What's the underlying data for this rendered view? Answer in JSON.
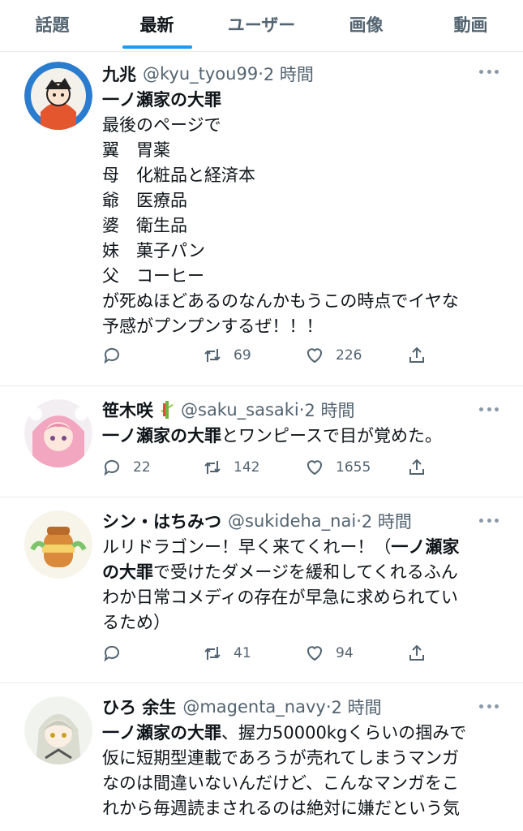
{
  "tabs": [
    {
      "label": "話題",
      "active": false
    },
    {
      "label": "最新",
      "active": true
    },
    {
      "label": "ユーザー",
      "active": false
    },
    {
      "label": "画像",
      "active": false
    },
    {
      "label": "動画",
      "active": false
    }
  ],
  "colors": {
    "accent": "#1d9bf0",
    "text": "#0f1419",
    "muted": "#536471",
    "divider": "#e7e9ea"
  },
  "tweets": [
    {
      "name": "九兆",
      "handle": "@kyu_tyou99",
      "dot": "·",
      "time": "2 時間",
      "lines": [
        {
          "bold": "一ノ瀬家の大罪",
          "text": ""
        },
        {
          "bold": "",
          "text": "最後のページで"
        },
        {
          "bold": "",
          "text": "翼　胃薬"
        },
        {
          "bold": "",
          "text": "母　化粧品と経済本"
        },
        {
          "bold": "",
          "text": "爺　医療品"
        },
        {
          "bold": "",
          "text": "婆　衛生品"
        },
        {
          "bold": "",
          "text": "妹　菓子パン"
        },
        {
          "bold": "",
          "text": "父　コーヒー"
        },
        {
          "bold": "",
          "text": "が死ぬほどあるのなんかもうこの時点でイヤな"
        },
        {
          "bold": "",
          "text": "予感がプンプンするぜ！！！"
        }
      ],
      "replies": "",
      "retweets": "69",
      "likes": "226"
    },
    {
      "name": "笹木咲",
      "handle": "@saku_sasaki",
      "dot": "·",
      "time": "2 時間",
      "lines": [
        {
          "bold": "一ノ瀬家の大罪",
          "text": "とワンピースで目が覚めた。"
        }
      ],
      "replies": "22",
      "retweets": "142",
      "likes": "1655"
    },
    {
      "name": "シン・はちみつ",
      "handle": "@sukideha_nai",
      "dot": "·",
      "time": "2 時間",
      "lines": [
        {
          "bold": "",
          "text": "ルリドラゴンー！早く来てくれー！（",
          "bold2": "一ノ瀬家"
        },
        {
          "bold": "の大罪",
          "text": "で受けたダメージを緩和してくれるふん"
        },
        {
          "bold": "",
          "text": "わか日常コメディの存在が早急に求められてい"
        },
        {
          "bold": "",
          "text": "るため）"
        }
      ],
      "replies": "",
      "retweets": "41",
      "likes": "94"
    },
    {
      "name": "ひろ 余生",
      "handle": "@magenta_navy",
      "dot": "·",
      "time": "2 時間",
      "lines": [
        {
          "bold": "一ノ瀬家の大罪",
          "text": "、握力50000kgくらいの掴みで"
        },
        {
          "bold": "",
          "text": "仮に短期型連載であろうが売れてしまうマンガ"
        },
        {
          "bold": "",
          "text": "なのは間違いないんだけど、こんなマンガをこ"
        },
        {
          "bold": "",
          "text": "れから毎週読まされるのは絶対に嫌だという気"
        }
      ]
    }
  ]
}
